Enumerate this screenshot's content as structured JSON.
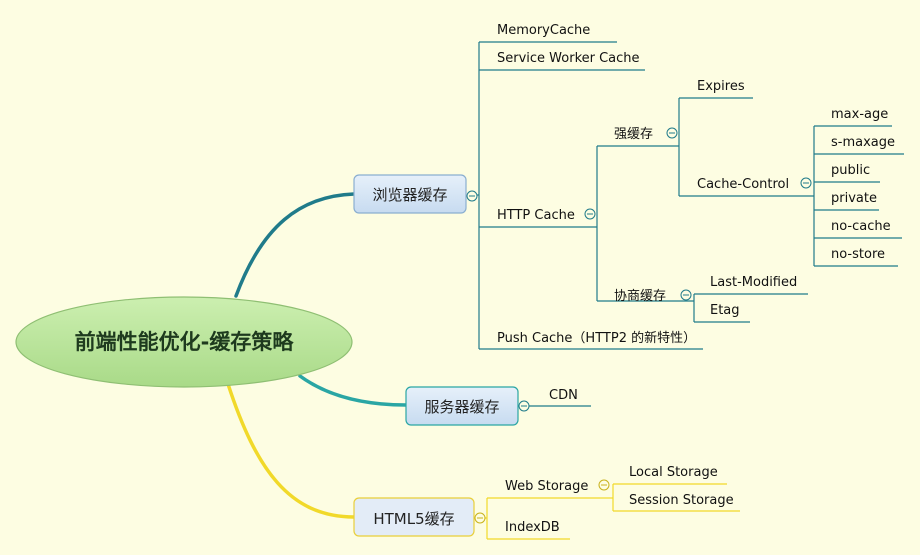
{
  "colors": {
    "background": "#fdfde2",
    "root_fill": "#b8e39a",
    "branch_fill": "#d3e4f5",
    "branch_stroke": "#8aaed0",
    "html5_fill": "#e3ecf7",
    "html5_stroke": "#e9cf3a",
    "teal": "#207b8a",
    "teal_light": "#2aa6a4",
    "yellow": "#f1d92a"
  },
  "root": {
    "label": "前端性能优化-缓存策略"
  },
  "browser_cache": {
    "label": "浏览器缓存",
    "memory_cache": "MemoryCache",
    "service_worker": "Service Worker Cache",
    "http_cache": {
      "label": "HTTP Cache",
      "strong": {
        "label": "强缓存",
        "expires": "Expires",
        "cache_control": {
          "label": "Cache-Control",
          "values": [
            "max-age",
            "s-maxage",
            "public",
            "private",
            "no-cache",
            "no-store"
          ]
        }
      },
      "negotiated": {
        "label": "协商缓存",
        "last_modified": "Last-Modified",
        "etag": "Etag"
      }
    },
    "push_cache": "Push Cache（HTTP2 的新特性）"
  },
  "server_cache": {
    "label": "服务器缓存",
    "cdn": "CDN"
  },
  "html5_cache": {
    "label": "HTML5缓存",
    "web_storage": {
      "label": "Web Storage",
      "local": "Local Storage",
      "session": "Session Storage"
    },
    "indexdb": "IndexDB"
  }
}
